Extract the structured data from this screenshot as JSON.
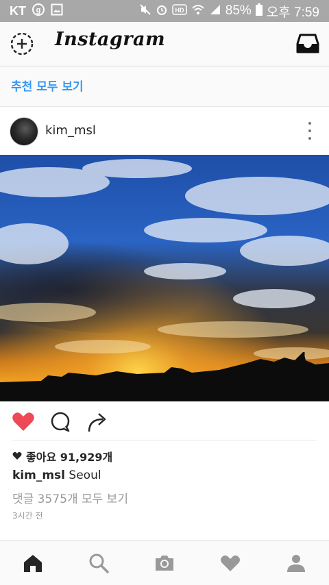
{
  "status_bar": {
    "carrier": "KT",
    "battery": "85%",
    "time": "오후 7:59"
  },
  "header": {
    "brand": "Instagram",
    "add_story_icon": "add-story-icon",
    "inbox_icon": "inbox-icon"
  },
  "suggestions": {
    "link": "추천 모두 보기"
  },
  "post": {
    "username": "kim_msl",
    "likes_text": "좋아요 91,929개",
    "caption_user": "kim_msl",
    "caption_text": "Seoul",
    "comments_text": "댓글 3575개 모두 보기",
    "time_ago": "3시간 전",
    "liked": true,
    "like_color": "#ed4956"
  },
  "bottom_nav": [
    "home-icon",
    "search-icon",
    "camera-icon",
    "heart-icon",
    "profile-icon"
  ],
  "colors": {
    "link": "#3897f0",
    "status_bar": "#a8a8a8"
  }
}
